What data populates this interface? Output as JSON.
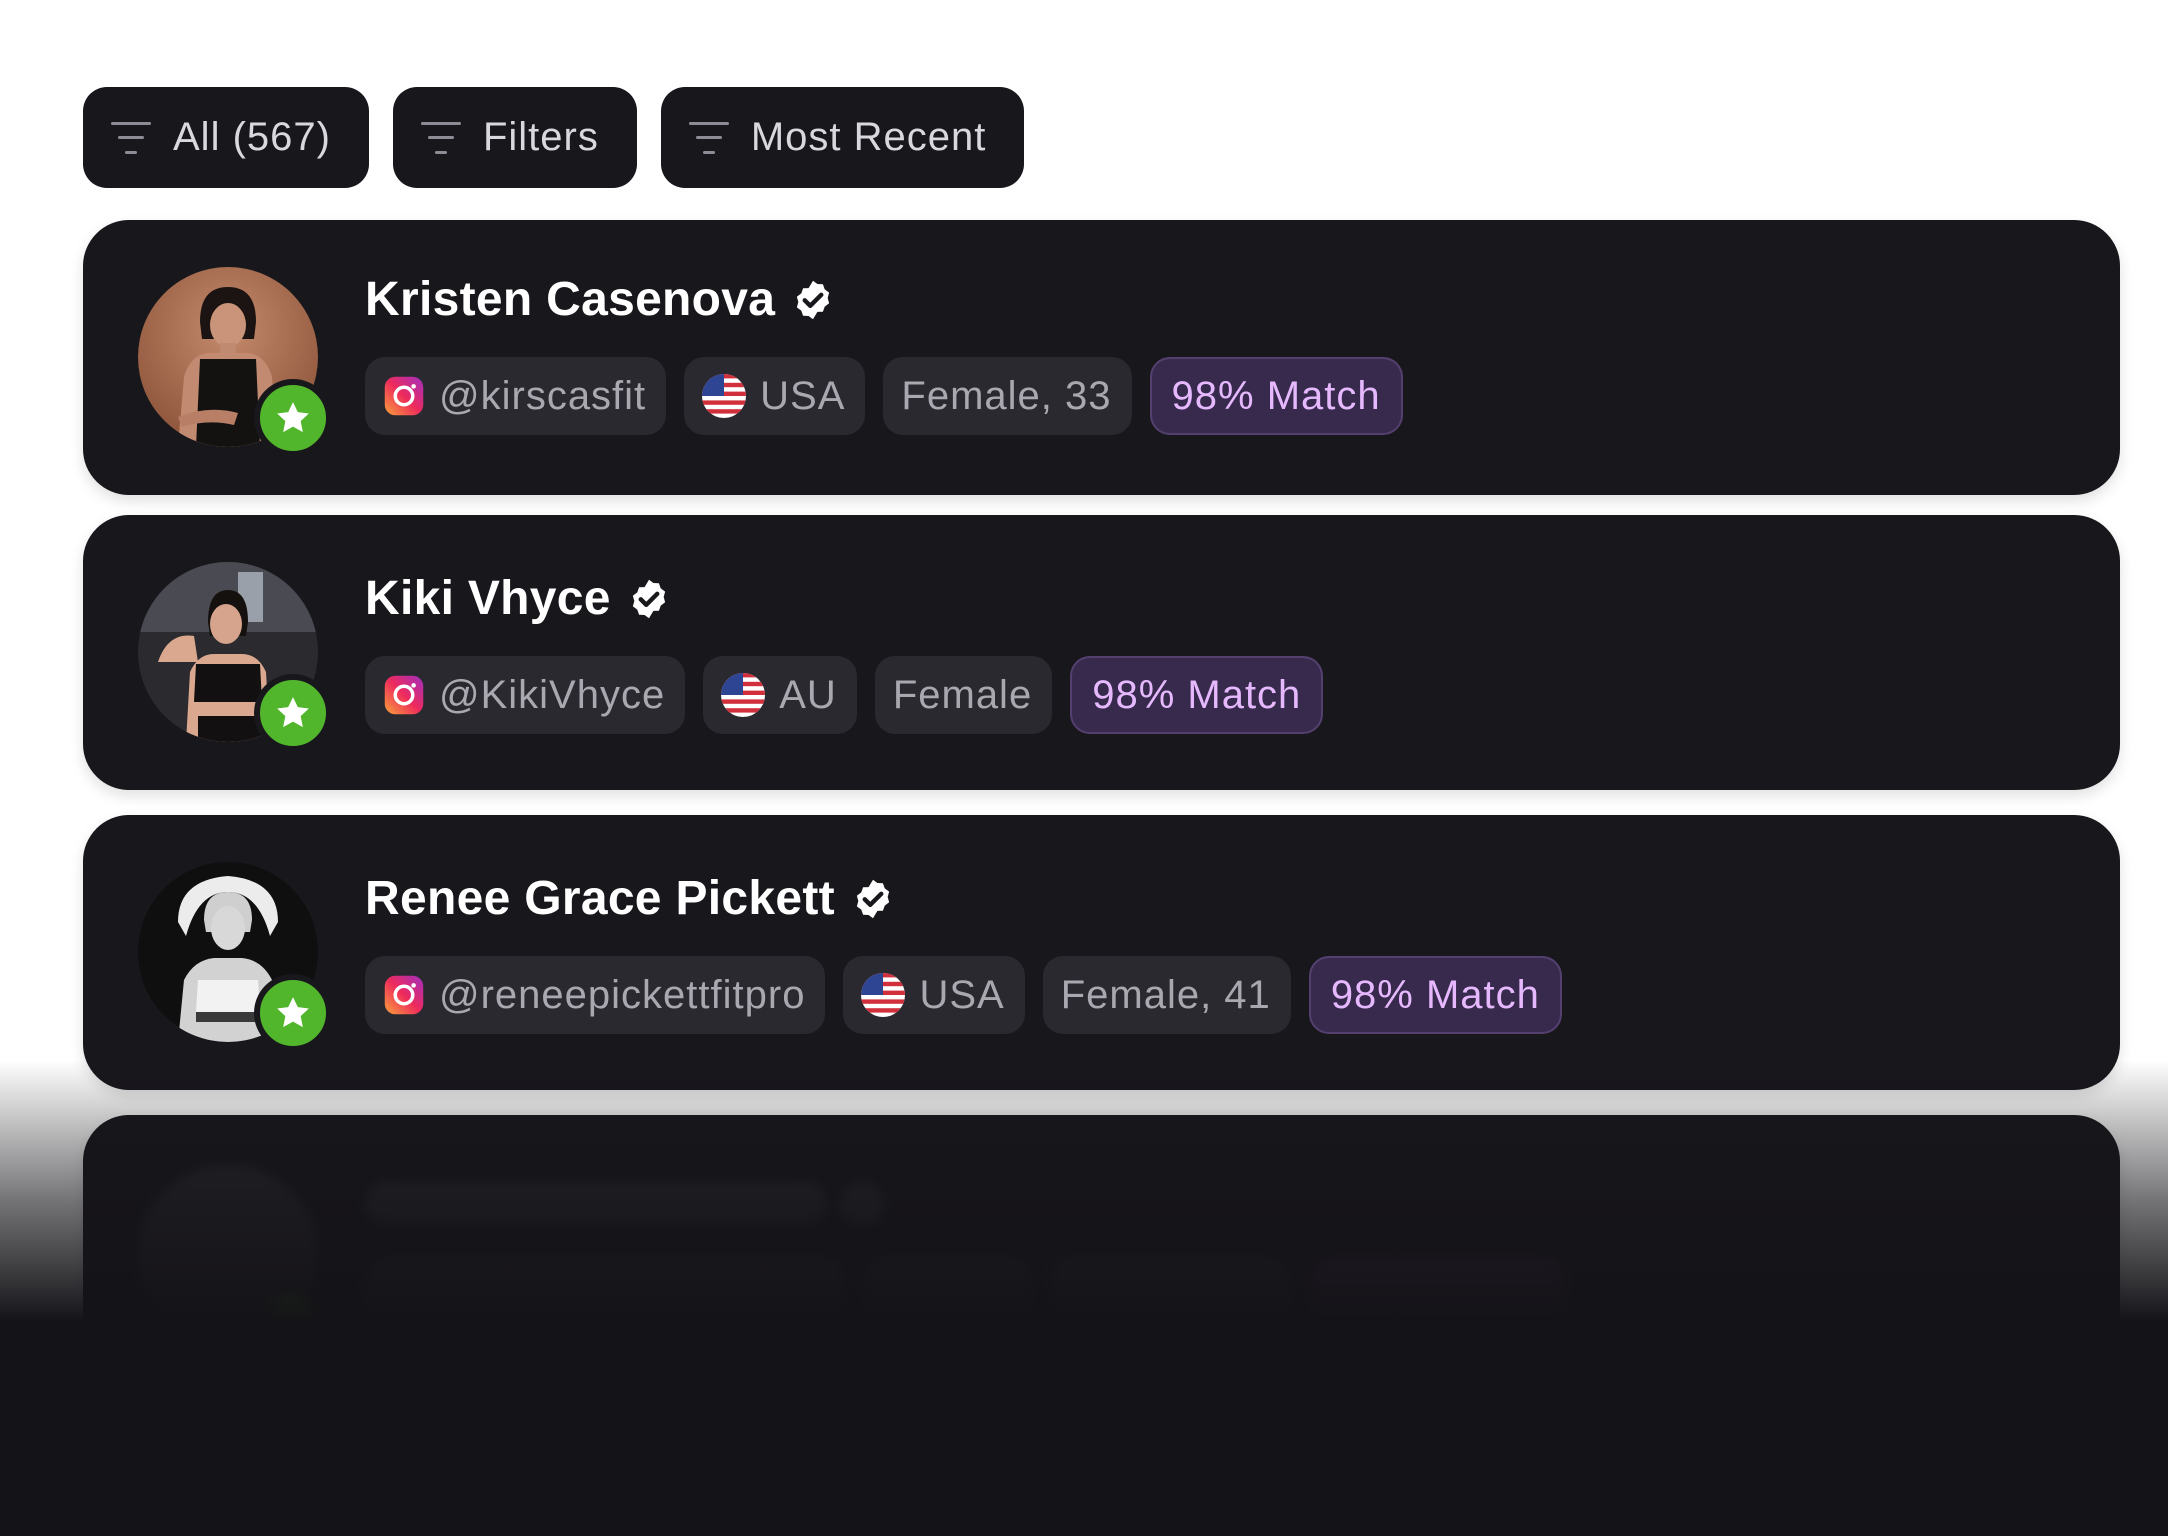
{
  "filters": [
    {
      "label": "All (567)"
    },
    {
      "label": "Filters"
    },
    {
      "label": "Most Recent"
    }
  ],
  "colors": {
    "card_bg": "#18171c",
    "chip_bg": "#2a2930",
    "match_text": "#e6b9ff",
    "match_bg": "#382a4c",
    "star_badge": "#52b62d",
    "page_bg": "#ffffff"
  },
  "creators": [
    {
      "name": "Kristen Casenova",
      "verified": true,
      "handle": "@kirscasfit",
      "country": "USA",
      "demographic": "Female, 33",
      "match": "98% Match",
      "flag_icon": "us-flag-icon"
    },
    {
      "name": "Kiki Vhyce",
      "verified": true,
      "handle": "@KikiVhyce",
      "country": "AU",
      "demographic": "Female",
      "match": "98% Match",
      "flag_icon": "us-flag-icon"
    },
    {
      "name": "Renee Grace Pickett",
      "verified": true,
      "handle": "@reneepickettfitpro",
      "country": "USA",
      "demographic": "Female, 41",
      "match": "98% Match",
      "flag_icon": "us-flag-icon"
    }
  ]
}
